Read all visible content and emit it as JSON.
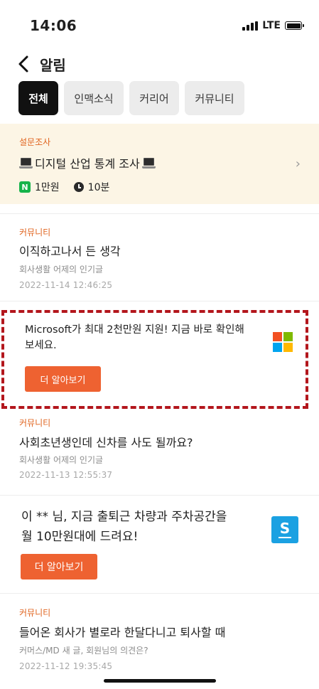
{
  "status": {
    "time": "14:06",
    "network": "LTE"
  },
  "header": {
    "title": "알림",
    "back_icon": "chevron-left-icon"
  },
  "tabs": [
    {
      "label": "전체",
      "active": true
    },
    {
      "label": "인맥소식",
      "active": false
    },
    {
      "label": "커리어",
      "active": false
    },
    {
      "label": "커뮤니티",
      "active": false
    }
  ],
  "survey": {
    "category": "설문조사",
    "title": "디지털 산업 통계 조사",
    "reward_icon": "naver-n-icon",
    "reward": "1만원",
    "duration_icon": "clock-icon",
    "duration": "10분"
  },
  "notifications": [
    {
      "category": "커뮤니티",
      "title": "이직하고나서 든 생각",
      "subtitle": "회사생활 어제의 인기글",
      "date": "2022-11-14 12:46:25"
    },
    {
      "category": "커뮤니티",
      "title": "사회초년생인데 신차를 사도 될까요?",
      "subtitle": "회사생활 어제의 인기글",
      "date": "2022-11-13 12:55:37"
    },
    {
      "category": "커뮤니티",
      "title": "들어온 회사가 별로라 한달다니고 퇴사할 때",
      "subtitle": "커머스/MD 새 글, 회원님의 의견은?",
      "date": "2022-11-12 19:35:45"
    }
  ],
  "ads": [
    {
      "line1": "Microsoft가 최대 2천만원 지원! 지금 바로 확인해",
      "line2": "보세요.",
      "button": "더 알아보기",
      "icon": "microsoft-logo-icon"
    },
    {
      "line1": "이 ** 님, 지금 출퇴근 차량과 주차공간을",
      "line2": "월 10만원대에 드려요!",
      "button": "더 알아보기",
      "icon": "s-app-logo-icon"
    }
  ],
  "colors": {
    "accent": "#e0641f",
    "button": "#ee6231",
    "survey_bg": "#fcf5e5",
    "ad_highlight": "#b3161c",
    "tab_active": "#111111"
  }
}
